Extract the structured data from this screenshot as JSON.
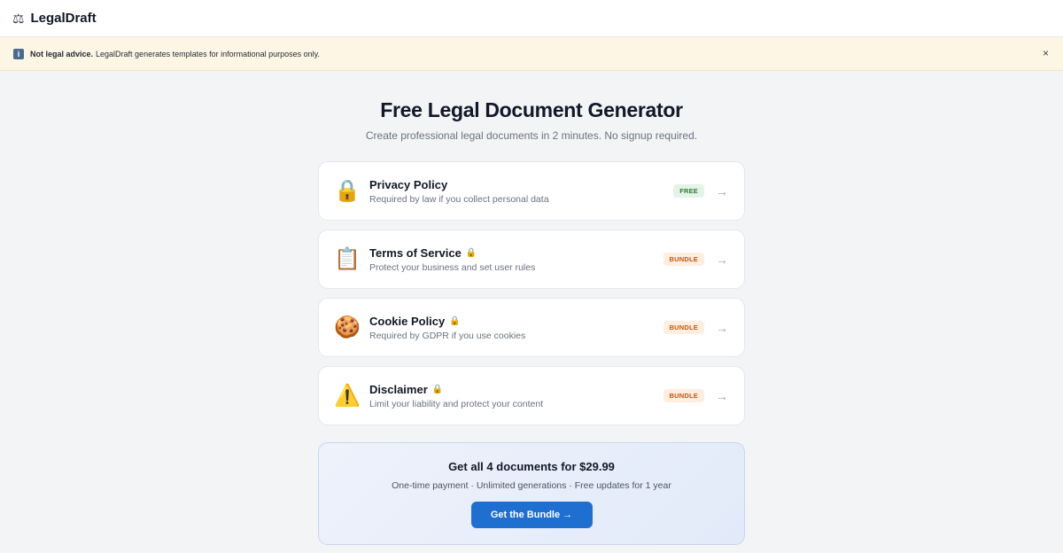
{
  "header": {
    "brand_icon": "⚖",
    "brand_name": "LegalDraft"
  },
  "notice": {
    "icon": "info-icon",
    "icon_glyph": "i",
    "strong": "Not legal advice.",
    "text": "LegalDraft generates templates for informational purposes only.",
    "close": "×"
  },
  "hero": {
    "title": "Free Legal Document Generator",
    "subtitle": "Create professional legal documents in 2 minutes. No signup required."
  },
  "documents": [
    {
      "emoji": "🔒",
      "icon": "padlock-icon",
      "title": "Privacy Policy",
      "locked": false,
      "description": "Required by law if you collect personal data",
      "badge": "FREE",
      "arrow": "→"
    },
    {
      "emoji": "📋",
      "icon": "clipboard-icon",
      "title": "Terms of Service",
      "locked": true,
      "lock": "🔒",
      "description": "Protect your business and set user rules",
      "badge": "BUNDLE",
      "arrow": "→"
    },
    {
      "emoji": "🍪",
      "icon": "cookie-icon",
      "title": "Cookie Policy",
      "locked": true,
      "lock": "🔒",
      "description": "Required by GDPR if you use cookies",
      "badge": "BUNDLE",
      "arrow": "→"
    },
    {
      "emoji": "⚠️",
      "icon": "warning-icon",
      "title": "Disclaimer",
      "locked": true,
      "lock": "🔒",
      "description": "Limit your liability and protect your content",
      "badge": "BUNDLE",
      "arrow": "→"
    }
  ],
  "bundle": {
    "title": "Get all 4 documents for $29.99",
    "subtitle": "One-time payment · Unlimited generations · Free updates for 1 year",
    "button": "Get the Bundle →"
  },
  "colors": {
    "accent": "#1f6fd1",
    "free_badge": "#2f7a3b",
    "bundle_badge": "#c25513",
    "notice_bg": "#fef6e4"
  }
}
